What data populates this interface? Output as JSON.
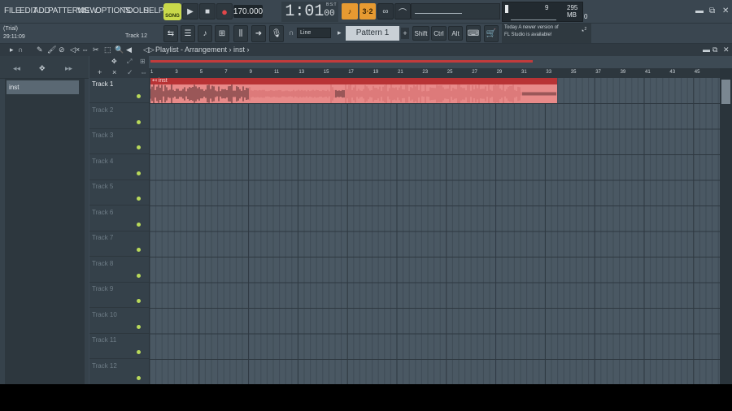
{
  "menu": [
    "FILE",
    "EDIT",
    "ADD",
    "PATTERNS",
    "VIEW",
    "OPTIONS",
    "TOOLS",
    "HELP"
  ],
  "transport": {
    "song_label": "SONG",
    "play": "▶",
    "stop": "■",
    "record": "●",
    "tempo": "170.000",
    "time": "1:01",
    "time_sub": "00",
    "bst": "B:S:T"
  },
  "cpu": {
    "cores": "9",
    "mem": "295 MB",
    "voices": "0"
  },
  "hint": {
    "trial": "(Trial)",
    "clock": "29:11:09",
    "track_label": "Track 12"
  },
  "toolbar": {
    "snap": "Line",
    "pattern": "Pattern 1",
    "shift": "Shift",
    "ctrl": "Ctrl",
    "alt": "Alt",
    "add": "+"
  },
  "news": {
    "line1": "Today  A newer version of",
    "line2": "FL Studio is available!",
    "badge": "2"
  },
  "playlist": {
    "breadcrumb": "Playlist - Arrangement › inst ›"
  },
  "browser": {
    "item": "inst"
  },
  "tracks": [
    "Track 1",
    "Track 2",
    "Track 3",
    "Track 4",
    "Track 5",
    "Track 6",
    "Track 7",
    "Track 8",
    "Track 9",
    "Track 10",
    "Track 11",
    "Track 12"
  ],
  "ruler": [
    "1",
    "3",
    "5",
    "7",
    "9",
    "11",
    "13",
    "15",
    "17",
    "19",
    "21",
    "23",
    "25",
    "27",
    "29",
    "31",
    "33",
    "35",
    "37",
    "39",
    "41",
    "43",
    "45"
  ],
  "clip": {
    "label": "inst"
  },
  "colors": {
    "clip": "#e88a89",
    "clip_header": "#b83335",
    "accent": "#e79a31",
    "song": "#c9d94a"
  }
}
